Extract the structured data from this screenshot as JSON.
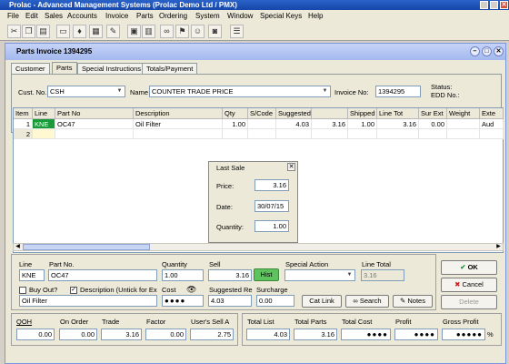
{
  "window": {
    "title": "Prolac - Advanced Management Systems (Prolac Demo Ltd / PMX)"
  },
  "menu": [
    "File",
    "Edit",
    "Sales",
    "Accounts",
    "Invoice",
    "Parts",
    "Ordering",
    "System",
    "Window",
    "Special Keys",
    "Help"
  ],
  "child": {
    "title": "Parts Invoice 1394295"
  },
  "tabs": [
    "Customer",
    "Parts",
    "Special Instructions",
    "Totals/Payment"
  ],
  "header": {
    "cust_label": "Cust. No.",
    "cust_value": "CSH",
    "name_label": "Name",
    "name_value": "COUNTER TRADE PRICE",
    "invoice_label": "Invoice No:",
    "invoice_value": "1394295",
    "status_label": "Status:",
    "edd_label": "EDD No.:"
  },
  "grid": {
    "columns": [
      "Item",
      "Line",
      "Part No",
      "Description",
      "Qty",
      "S/Code",
      "Suggested Sell",
      "",
      "Shipped",
      "Line Tot",
      "Sur Ext",
      "Weight",
      "Exte"
    ],
    "rows": [
      {
        "item": "1",
        "line": "KNE",
        "part": "OC47",
        "desc": "Oil Filter",
        "qty": "1.00",
        "scode": "",
        "sugg": "4.03",
        "sell": "3.16",
        "shipped": "1.00",
        "linetot": "3.16",
        "surext": "0.00",
        "weight": "",
        "ext": "Aud"
      },
      {
        "item": "2",
        "line": "",
        "part": "",
        "desc": "",
        "qty": "",
        "scode": "",
        "sugg": "",
        "sell": "",
        "shipped": "",
        "linetot": "",
        "surext": "",
        "weight": "",
        "ext": ""
      }
    ]
  },
  "last_sale": {
    "title": "Last Sale",
    "price_label": "Price:",
    "price": "3.16",
    "date_label": "Date:",
    "date": "30/07/15",
    "qty_label": "Quantity:",
    "qty": "1.00"
  },
  "detail": {
    "line_label": "Line",
    "line": "KNE",
    "partno_label": "Part No.",
    "partno": "OC47",
    "qty_label": "Quantity",
    "qty": "1.00",
    "sell_label": "Sell",
    "sell": "3.16",
    "hist_label": "Hist",
    "special_label": "Special Action",
    "linetotal_label": "Line Total",
    "linetotal": "3.16",
    "buyout_label": "Buy Out?",
    "desc_check_label": "Description (Untick for Ex",
    "desc": "Oil Filter",
    "cost_label": "Cost",
    "cost": "●●●●",
    "sugg_label": "Suggested Re",
    "sugg": "4.03",
    "surcharge_label": "Surcharge",
    "surcharge": "0.00",
    "catlink_label": "Cat Link",
    "search_label": "Search",
    "notes_label": "Notes"
  },
  "buttons": {
    "ok": "OK",
    "cancel": "Cancel",
    "delete": "Delete"
  },
  "stats": {
    "qoh_label": "QOH",
    "qoh": "0.00",
    "onorder_label": "On Order",
    "onorder": "0.00",
    "trade_label": "Trade",
    "trade": "3.16",
    "factor_label": "Factor",
    "factor": "0.00",
    "usersell_label": "User's Sell A",
    "usersell": "2.75",
    "totallist_label": "Total List",
    "totallist": "4.03",
    "totalparts_label": "Total Parts",
    "totalparts": "3.16",
    "totalcost_label": "Total Cost",
    "totalcost": "●●●●",
    "profit_label": "Profit",
    "profit": "●●●●",
    "grossprofit_label": "Gross Profit",
    "grossprofit": "●●●●●",
    "percent": "%"
  }
}
